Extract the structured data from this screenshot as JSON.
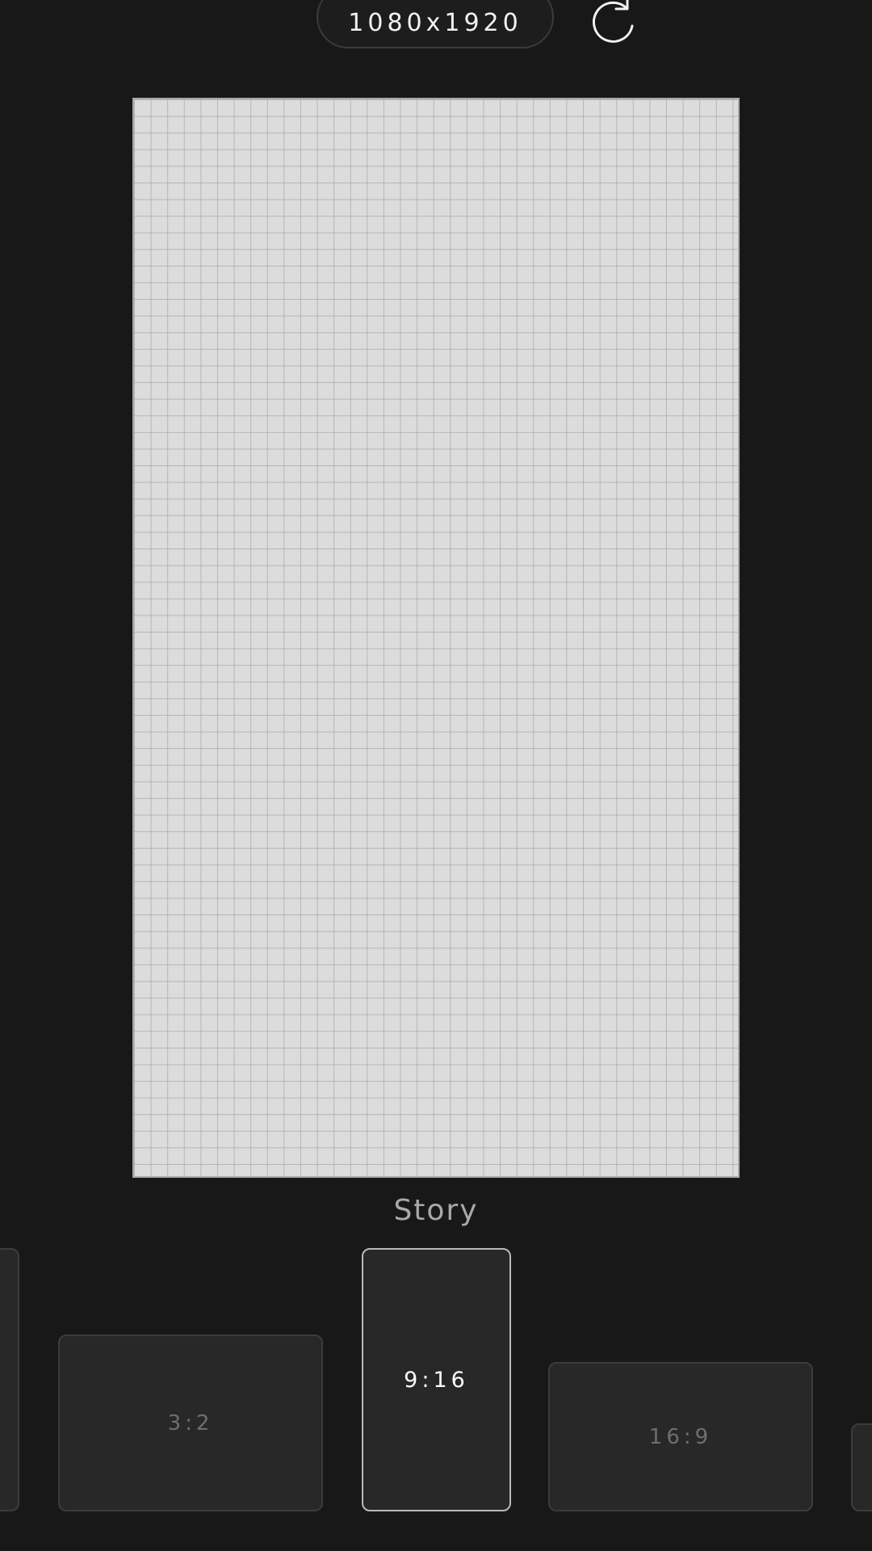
{
  "header": {
    "size_label": "1080x1920",
    "rotate_icon": "rotate-icon"
  },
  "canvas": {
    "background": "#dcdcdc",
    "grid_color": "#969696"
  },
  "preset": {
    "name": "Story"
  },
  "ratios": {
    "items": [
      {
        "label": "",
        "selected": false
      },
      {
        "label": "3:2",
        "selected": false
      },
      {
        "label": "9:16",
        "selected": true
      },
      {
        "label": "16:9",
        "selected": false
      },
      {
        "label": "",
        "selected": false
      }
    ]
  },
  "colors": {
    "background": "#181818",
    "card": "#282828",
    "card_border": "#3c3c3c",
    "selected_border": "#b9b9b9"
  }
}
